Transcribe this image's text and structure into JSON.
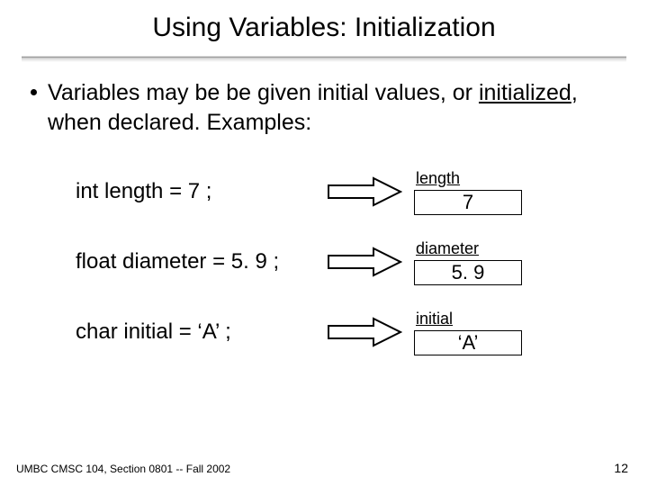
{
  "title": "Using Variables: Initialization",
  "bullet": {
    "pre": "Variables may be be given initial values, or ",
    "underlined": "initialized",
    "post": ", when declared.  Examples:"
  },
  "examples": [
    {
      "code": "int length = 7 ;",
      "label": "length",
      "value": "7"
    },
    {
      "code": "float diameter = 5. 9 ;",
      "label": "diameter",
      "value": "5. 9"
    },
    {
      "code": "char initial = ‘A’ ;",
      "label": "initial",
      "value": "‘A’"
    }
  ],
  "footer": "UMBC CMSC 104, Section 0801 -- Fall 2002",
  "pagenum": "12"
}
